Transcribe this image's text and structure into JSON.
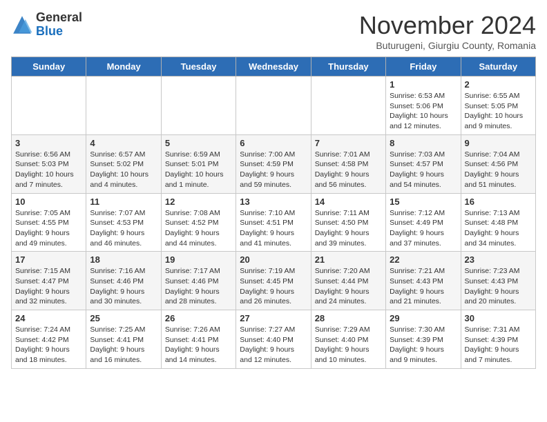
{
  "header": {
    "logo_general": "General",
    "logo_blue": "Blue",
    "month_title": "November 2024",
    "subtitle": "Buturugeni, Giurgiu County, Romania"
  },
  "weekdays": [
    "Sunday",
    "Monday",
    "Tuesday",
    "Wednesday",
    "Thursday",
    "Friday",
    "Saturday"
  ],
  "weeks": [
    [
      {
        "day": "",
        "info": ""
      },
      {
        "day": "",
        "info": ""
      },
      {
        "day": "",
        "info": ""
      },
      {
        "day": "",
        "info": ""
      },
      {
        "day": "",
        "info": ""
      },
      {
        "day": "1",
        "info": "Sunrise: 6:53 AM\nSunset: 5:06 PM\nDaylight: 10 hours and 12 minutes."
      },
      {
        "day": "2",
        "info": "Sunrise: 6:55 AM\nSunset: 5:05 PM\nDaylight: 10 hours and 9 minutes."
      }
    ],
    [
      {
        "day": "3",
        "info": "Sunrise: 6:56 AM\nSunset: 5:03 PM\nDaylight: 10 hours and 7 minutes."
      },
      {
        "day": "4",
        "info": "Sunrise: 6:57 AM\nSunset: 5:02 PM\nDaylight: 10 hours and 4 minutes."
      },
      {
        "day": "5",
        "info": "Sunrise: 6:59 AM\nSunset: 5:01 PM\nDaylight: 10 hours and 1 minute."
      },
      {
        "day": "6",
        "info": "Sunrise: 7:00 AM\nSunset: 4:59 PM\nDaylight: 9 hours and 59 minutes."
      },
      {
        "day": "7",
        "info": "Sunrise: 7:01 AM\nSunset: 4:58 PM\nDaylight: 9 hours and 56 minutes."
      },
      {
        "day": "8",
        "info": "Sunrise: 7:03 AM\nSunset: 4:57 PM\nDaylight: 9 hours and 54 minutes."
      },
      {
        "day": "9",
        "info": "Sunrise: 7:04 AM\nSunset: 4:56 PM\nDaylight: 9 hours and 51 minutes."
      }
    ],
    [
      {
        "day": "10",
        "info": "Sunrise: 7:05 AM\nSunset: 4:55 PM\nDaylight: 9 hours and 49 minutes."
      },
      {
        "day": "11",
        "info": "Sunrise: 7:07 AM\nSunset: 4:53 PM\nDaylight: 9 hours and 46 minutes."
      },
      {
        "day": "12",
        "info": "Sunrise: 7:08 AM\nSunset: 4:52 PM\nDaylight: 9 hours and 44 minutes."
      },
      {
        "day": "13",
        "info": "Sunrise: 7:10 AM\nSunset: 4:51 PM\nDaylight: 9 hours and 41 minutes."
      },
      {
        "day": "14",
        "info": "Sunrise: 7:11 AM\nSunset: 4:50 PM\nDaylight: 9 hours and 39 minutes."
      },
      {
        "day": "15",
        "info": "Sunrise: 7:12 AM\nSunset: 4:49 PM\nDaylight: 9 hours and 37 minutes."
      },
      {
        "day": "16",
        "info": "Sunrise: 7:13 AM\nSunset: 4:48 PM\nDaylight: 9 hours and 34 minutes."
      }
    ],
    [
      {
        "day": "17",
        "info": "Sunrise: 7:15 AM\nSunset: 4:47 PM\nDaylight: 9 hours and 32 minutes."
      },
      {
        "day": "18",
        "info": "Sunrise: 7:16 AM\nSunset: 4:46 PM\nDaylight: 9 hours and 30 minutes."
      },
      {
        "day": "19",
        "info": "Sunrise: 7:17 AM\nSunset: 4:46 PM\nDaylight: 9 hours and 28 minutes."
      },
      {
        "day": "20",
        "info": "Sunrise: 7:19 AM\nSunset: 4:45 PM\nDaylight: 9 hours and 26 minutes."
      },
      {
        "day": "21",
        "info": "Sunrise: 7:20 AM\nSunset: 4:44 PM\nDaylight: 9 hours and 24 minutes."
      },
      {
        "day": "22",
        "info": "Sunrise: 7:21 AM\nSunset: 4:43 PM\nDaylight: 9 hours and 21 minutes."
      },
      {
        "day": "23",
        "info": "Sunrise: 7:23 AM\nSunset: 4:43 PM\nDaylight: 9 hours and 20 minutes."
      }
    ],
    [
      {
        "day": "24",
        "info": "Sunrise: 7:24 AM\nSunset: 4:42 PM\nDaylight: 9 hours and 18 minutes."
      },
      {
        "day": "25",
        "info": "Sunrise: 7:25 AM\nSunset: 4:41 PM\nDaylight: 9 hours and 16 minutes."
      },
      {
        "day": "26",
        "info": "Sunrise: 7:26 AM\nSunset: 4:41 PM\nDaylight: 9 hours and 14 minutes."
      },
      {
        "day": "27",
        "info": "Sunrise: 7:27 AM\nSunset: 4:40 PM\nDaylight: 9 hours and 12 minutes."
      },
      {
        "day": "28",
        "info": "Sunrise: 7:29 AM\nSunset: 4:40 PM\nDaylight: 9 hours and 10 minutes."
      },
      {
        "day": "29",
        "info": "Sunrise: 7:30 AM\nSunset: 4:39 PM\nDaylight: 9 hours and 9 minutes."
      },
      {
        "day": "30",
        "info": "Sunrise: 7:31 AM\nSunset: 4:39 PM\nDaylight: 9 hours and 7 minutes."
      }
    ]
  ]
}
